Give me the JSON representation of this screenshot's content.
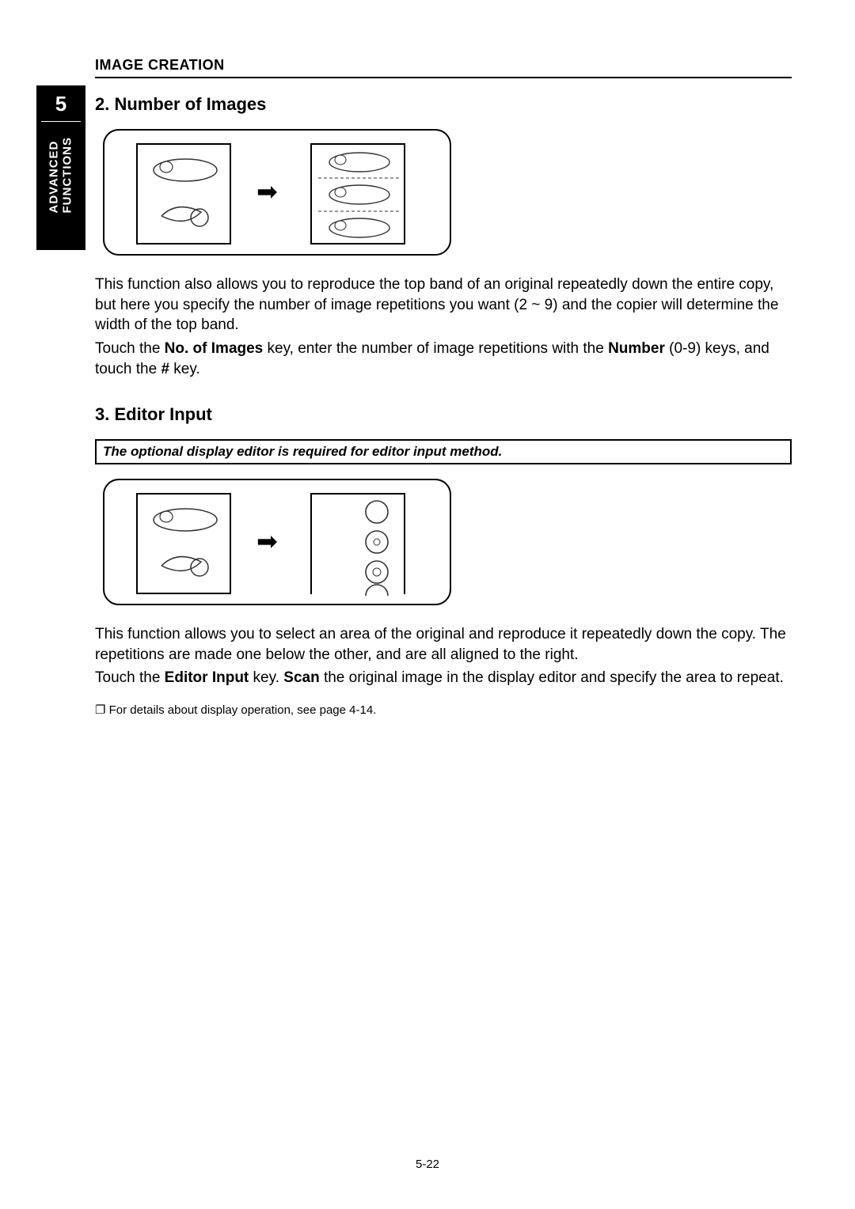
{
  "header": {
    "title": "IMAGE CREATION"
  },
  "tab": {
    "number": "5",
    "line1": "ADVANCED",
    "line2": "FUNCTIONS"
  },
  "section2": {
    "heading": "2. Number of Images",
    "para1": "This function also allows you to reproduce the top band of an original repeatedly down the entire copy, but here you specify the number of image repetitions you want (2 ~ 9) and the copier will determine the width of the top band.",
    "para2a": "Touch the ",
    "para2b": "No. of Images",
    "para2c": " key, enter the number of image repetitions with the ",
    "para2d": "Number",
    "para2e": " (0-9) keys, and touch the ",
    "para2f": "#",
    "para2g": " key."
  },
  "section3": {
    "heading": "3. Editor Input",
    "note": "The optional display editor is required for editor input method.",
    "para1": "This function allows you to select an area of the original and reproduce it repeatedly down the copy. The repetitions are made one below the other, and are all aligned to the right.",
    "para2a": "Touch the ",
    "para2b": "Editor Input",
    "para2c": " key. ",
    "para2d": "Scan",
    "para2e": " the original image in the display editor and specify the area to repeat.",
    "bullet": "❐ For details about display operation, see page 4-14."
  },
  "footer": {
    "pagenum": "5-22"
  }
}
